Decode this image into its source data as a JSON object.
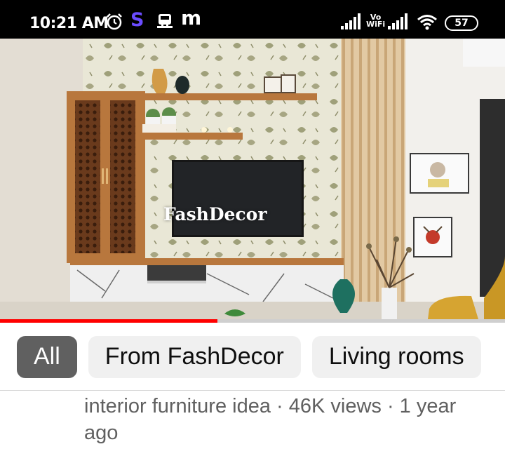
{
  "status_bar": {
    "time": "10:21 AM",
    "left_icons": [
      "alarm-icon",
      "s-app-icon",
      "train-icon",
      "m-app-icon"
    ],
    "s_glyph": "S",
    "m_glyph": "m",
    "volte_line1": "Vo",
    "volte_line2": "WiFi",
    "battery": "57"
  },
  "video": {
    "watermark": "FashDecor",
    "progress_fraction": 0.43
  },
  "chips": [
    {
      "label": "All",
      "selected": true
    },
    {
      "label": "From FashDecor",
      "selected": false
    },
    {
      "label": "Living rooms",
      "selected": false
    }
  ],
  "meta": {
    "line": "interior furniture idea · 46K views · 1 year ago"
  },
  "colors": {
    "progress": "#ff0000",
    "chip_selected": "#606060",
    "chip_default": "#f0f0f0",
    "s_app": "#6b4cff"
  }
}
